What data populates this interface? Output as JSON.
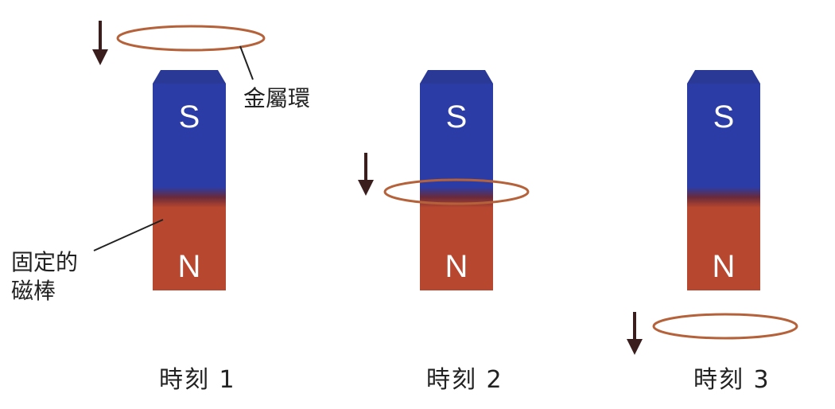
{
  "colors": {
    "south": "#2a3aa0",
    "north": "#b8472f",
    "ring": "#b5623a",
    "arrow": "#3a1d1d"
  },
  "poles": {
    "south": "S",
    "north": "N"
  },
  "labels": {
    "ring": "金屬環",
    "magnet_line1": "固定的",
    "magnet_line2": "磁棒"
  },
  "moments": [
    {
      "label": "時刻 1",
      "ring_position": "above magnet"
    },
    {
      "label": "時刻 2",
      "ring_position": "at middle of magnet"
    },
    {
      "label": "時刻 3",
      "ring_position": "below magnet"
    }
  ],
  "motion": "ring falls downward"
}
